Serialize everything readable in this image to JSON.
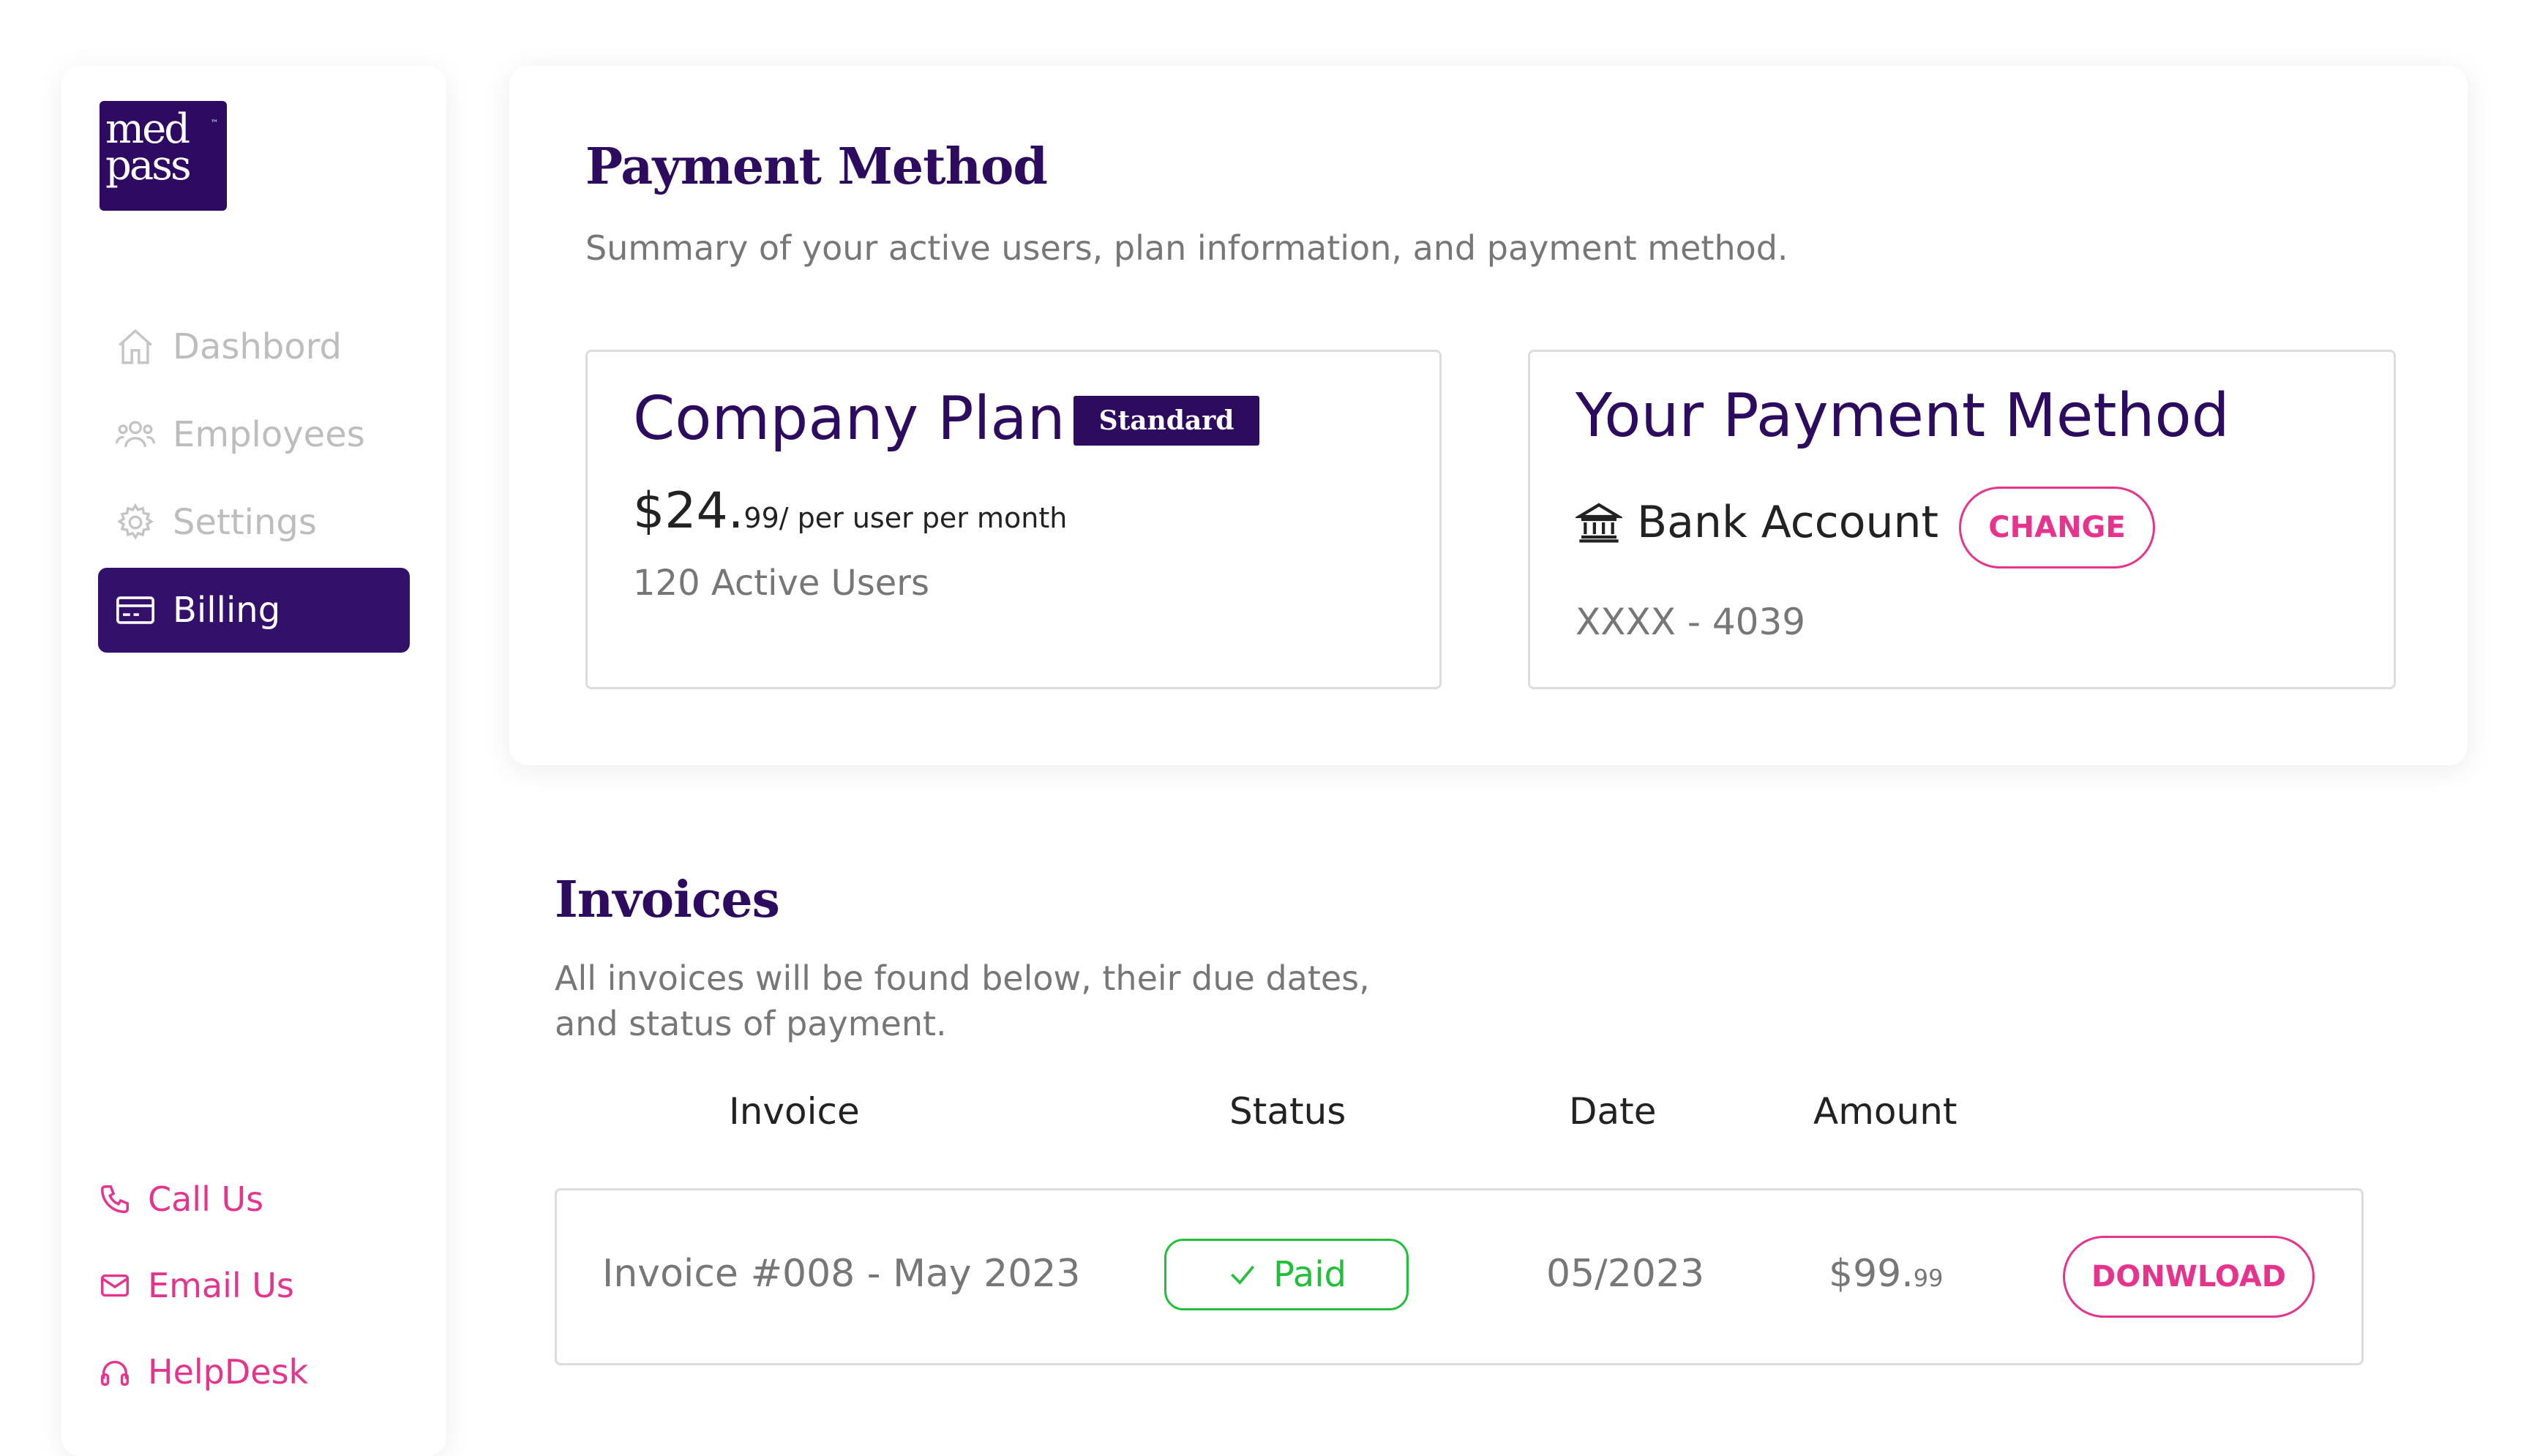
{
  "logo": {
    "line1": "med",
    "line2": "pass",
    "tm": "™"
  },
  "sidebar": {
    "items": [
      {
        "label": "Dashbord",
        "icon": "home-icon"
      },
      {
        "label": "Employees",
        "icon": "users-icon"
      },
      {
        "label": "Settings",
        "icon": "gear-icon"
      },
      {
        "label": "Billing",
        "icon": "credit-card-icon",
        "active": true
      }
    ],
    "contacts": [
      {
        "label": "Call Us",
        "icon": "phone-icon"
      },
      {
        "label": "Email Us",
        "icon": "mail-icon"
      },
      {
        "label": "HelpDesk",
        "icon": "headphones-icon"
      }
    ]
  },
  "payment": {
    "title": "Payment Method",
    "subtitle": "Summary of your active users, plan information, and payment method.",
    "plan": {
      "title": "Company Plan",
      "badge": "Standard",
      "price_main": "$24.",
      "price_cents": "99",
      "price_suffix": "/ per user per month",
      "active_users": "120 Active Users"
    },
    "method": {
      "title": "Your Payment Method",
      "type": "Bank Account",
      "change_label": "CHANGE",
      "account": "XXXX - 4039"
    }
  },
  "invoices": {
    "title": "Invoices",
    "subtitle_line1": "All invoices will be found below, their due dates,",
    "subtitle_line2": "and status of payment.",
    "columns": [
      "Invoice",
      "Status",
      "Date",
      "Amount"
    ],
    "rows": [
      {
        "invoice": "Invoice #008 - May 2023",
        "status": "Paid",
        "date": "05/2023",
        "amount_main": "$99.",
        "amount_cents": "99",
        "action": "DONWLOAD"
      }
    ]
  },
  "colors": {
    "brand": "#2d0b5e",
    "accent": "#e5338e",
    "success": "#22c03a"
  }
}
